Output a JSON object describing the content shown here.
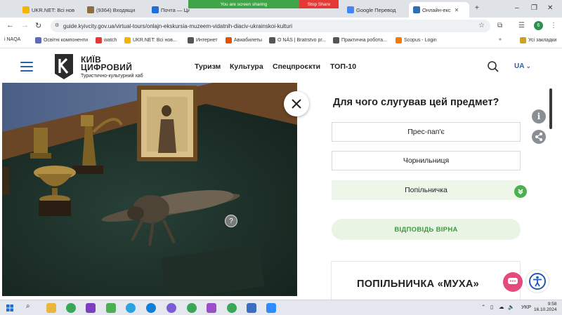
{
  "browser": {
    "tabs": [
      {
        "title": "UKR.NET: Всі нов",
        "color": "#f5b400"
      },
      {
        "title": "(9364) Входящи",
        "color": "#8d6e3f"
      },
      {
        "title": "Почта — Ци",
        "color": "#1e6fd9"
      },
      {
        "title": "You are screen sharing",
        "color": "#3fa447"
      },
      {
        "title": "Google Перевод",
        "color": "#4285f4"
      },
      {
        "title": "Онлайн-екс",
        "color": "#2f6fb8"
      }
    ],
    "share": {
      "text": "You are screen sharing",
      "stop": "Stop Share"
    },
    "url": "guide.kyivcity.gov.ua/virtual-tours/onlajn-ekskursia-muzeem-vidatnih-diaciv-ukrainskoi-kulturi",
    "profile_initial": "6",
    "bookmarks": [
      {
        "label": "i NAQA",
        "color": "#c62828"
      },
      {
        "label": "Освітні компоненти",
        "color": "#5c6bc0"
      },
      {
        "label": "watch",
        "color": "#e53935"
      },
      {
        "label": "UKR.NET: Всі нов...",
        "color": "#f5b400"
      },
      {
        "label": "Интернет",
        "color": "#555555"
      },
      {
        "label": "Авиабилеты",
        "color": "#e65100"
      },
      {
        "label": "О NÁS | Bratrstvo pr...",
        "color": "#555555"
      },
      {
        "label": "Практична робота...",
        "color": "#555555"
      },
      {
        "label": "Scopus - Login",
        "color": "#f57c00"
      },
      {
        "label": "Усі закладки",
        "color": "#c9a227"
      }
    ]
  },
  "site": {
    "logo_title_line1": "КИЇВ",
    "logo_title_line2": "ЦИФРОВИЙ",
    "logo_subtitle": "Туристично-культурний хаб",
    "nav": [
      "Туризм",
      "Культура",
      "Спецпроєкти",
      "ТОП-10"
    ],
    "language": "UA",
    "brand_color": "#2a61a0"
  },
  "quiz": {
    "question": "Для чого слугував цей предмет?",
    "options": [
      {
        "label": "Прес-пап'є",
        "selected": false
      },
      {
        "label": "Чорнильниця",
        "selected": false
      },
      {
        "label": "Попільничка",
        "selected": true
      }
    ],
    "result": "ВІДПОВІДЬ ВІРНА",
    "answer_title": "ПОПІЛЬНИЧКА «МУХА»",
    "correct_color": "#4caf50"
  },
  "photo": {
    "hotspot_label": "?"
  },
  "side": {
    "info_label": "i"
  },
  "taskbar": {
    "language": "УКР",
    "time": "9:58",
    "date": "16.10.2024"
  }
}
